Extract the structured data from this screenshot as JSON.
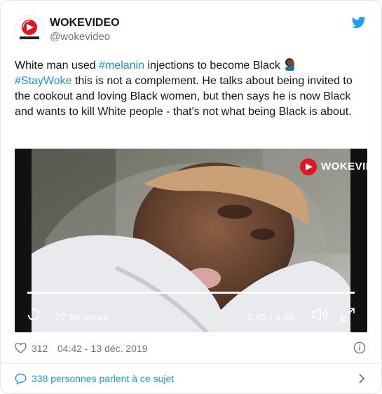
{
  "tweet": {
    "display_name": "WOKEVIDEO",
    "handle": "@wokevideo",
    "text_1": "White man used ",
    "hashtag_1": "#melanin",
    "text_2": " injections to become Black ",
    "hashtag_2": "#StayWoke",
    "text_3": " this is not a complement. He talks about being invited to the cookout and loving Black women, but then says he is now Black and wants to kill White people - that's not what being Black is about."
  },
  "video": {
    "watermark": "WOKEVIDI",
    "views": "27.6K views",
    "time": "0:45 / 0:45",
    "progress": 1.0
  },
  "footer": {
    "likes": "312",
    "timestamp": "04:42 - 13 déc. 2019",
    "conversation": "338 personnes parlent à ce sujet"
  },
  "colors": {
    "link": "#1b95e0",
    "muted": "#657786",
    "brand_red": "#e0151f",
    "twitter_blue": "#1da1f2"
  },
  "icons": [
    "wokevideo-logo-icon",
    "twitter-bird-icon",
    "person-facepalm-emoji-icon",
    "replay-icon",
    "volume-icon",
    "fullscreen-icon",
    "heart-icon",
    "info-icon",
    "speech-bubble-icon",
    "chevron-right-icon"
  ]
}
